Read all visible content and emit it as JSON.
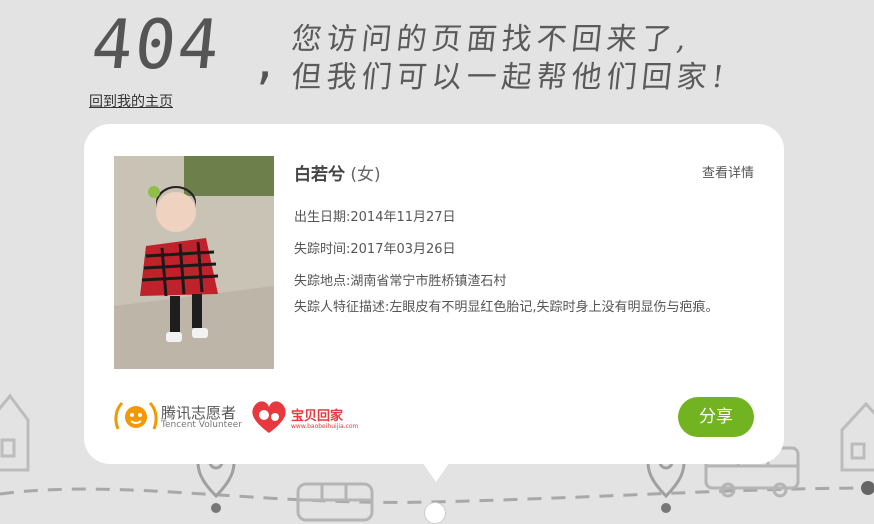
{
  "heading": {
    "code": "404",
    "comma": ",",
    "line1": "您访问的页面找不回来了,",
    "line2": "但我们可以一起帮他们回家!"
  },
  "home_link": "回到我的主页",
  "person": {
    "name": "白若兮",
    "gender": "(女)",
    "detail_link": "查看详情",
    "birth": "出生日期:2014年11月27日",
    "missing_time": "失踪时间:2017年03月26日",
    "missing_place": "失踪地点:湖南省常宁市胜桥镇渣石村",
    "features": "失踪人特征描述:左眼皮有不明显红色胎记,失踪时身上没有明显伤与疤痕。"
  },
  "logos": {
    "tencent_cn": "腾讯志愿者",
    "tencent_en": "Tencent Volunteer",
    "baobei": "宝贝回家",
    "baobei_url": "www.baobeihuijia.com"
  },
  "share_label": "分享",
  "colors": {
    "accent": "#72b321",
    "background": "#e3e3e3",
    "tencent": "#f39800",
    "baobei": "#e8383d"
  }
}
